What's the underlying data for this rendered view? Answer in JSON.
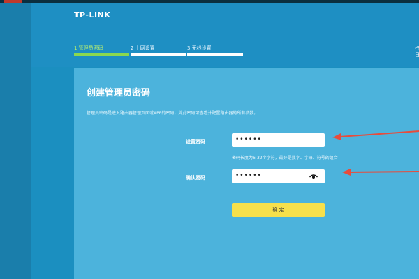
{
  "header": {
    "logo": "TP-LINK"
  },
  "steps": [
    {
      "label": "1 管理员密码",
      "active": true
    },
    {
      "label": "2 上网设置",
      "active": false
    },
    {
      "label": "3 无线设置",
      "active": false
    }
  ],
  "right_text": {
    "line1": "扫",
    "line2": "日"
  },
  "panel": {
    "title": "创建管理员密码",
    "description": "管理员密码是进入路由器管理页面或APP的密码，凭此密码可查看并配置路由器的所有参数。",
    "password_label": "设置密码",
    "password_value": "••••••",
    "password_hint": "密码长度为6-32个字符，最好是数字、字母、符号的组合",
    "confirm_label": "确认密码",
    "confirm_value": "••••••",
    "confirm_button": "确 定"
  },
  "colors": {
    "primary": "#1e8fc3",
    "panel": "#4cb3dc",
    "active_step": "#8bd84f",
    "button": "#f7e04b",
    "arrow": "#e74c3c"
  }
}
